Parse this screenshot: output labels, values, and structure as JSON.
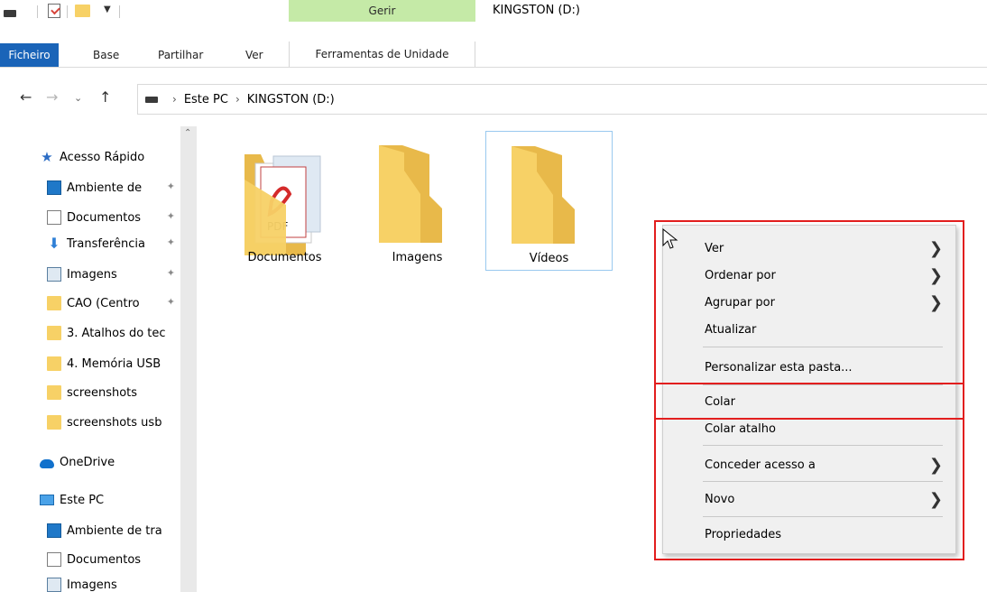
{
  "window": {
    "title": "KINGSTON (D:)",
    "contextual_group": "Gerir"
  },
  "ribbon": {
    "tabs": [
      "Ficheiro",
      "Base",
      "Partilhar",
      "Ver",
      "Ferramentas de Unidade"
    ],
    "active_tab": "Ficheiro"
  },
  "address": {
    "crumbs": [
      "Este PC",
      "KINGSTON (D:)"
    ]
  },
  "sidebar": {
    "quick_access_label": "Acesso Rápido",
    "quick_items": [
      {
        "label": "Ambiente de",
        "icon": "desktop-icon",
        "pinned": true
      },
      {
        "label": "Documentos",
        "icon": "documents-icon",
        "pinned": true
      },
      {
        "label": "Transferência",
        "icon": "download-icon",
        "pinned": true
      },
      {
        "label": "Imagens",
        "icon": "pictures-icon",
        "pinned": true
      },
      {
        "label": "CAO (Centro",
        "icon": "folder-icon",
        "pinned": true
      },
      {
        "label": "3. Atalhos do tec",
        "icon": "folder-icon",
        "pinned": false
      },
      {
        "label": "4. Memória USB",
        "icon": "folder-icon",
        "pinned": false
      },
      {
        "label": "screenshots",
        "icon": "folder-icon",
        "pinned": false
      },
      {
        "label": "screenshots usb",
        "icon": "folder-icon",
        "pinned": false
      }
    ],
    "onedrive_label": "OneDrive",
    "this_pc_label": "Este PC",
    "pc_items": [
      {
        "label": "Ambiente de tra",
        "icon": "desktop-icon"
      },
      {
        "label": "Documentos",
        "icon": "documents-icon"
      },
      {
        "label": "Imagens",
        "icon": "pictures-icon"
      }
    ]
  },
  "files": [
    {
      "name": "Documentos",
      "icon": "pdf-folder-icon",
      "selected": false
    },
    {
      "name": "Imagens",
      "icon": "folder-icon",
      "selected": false
    },
    {
      "name": "Vídeos",
      "icon": "folder-icon",
      "selected": true
    }
  ],
  "context_menu": {
    "items": [
      {
        "label": "Ver",
        "submenu": true
      },
      {
        "label": "Ordenar por",
        "submenu": true
      },
      {
        "label": "Agrupar por",
        "submenu": true
      },
      {
        "label": "Atualizar",
        "submenu": false
      },
      {
        "label": "Personalizar esta pasta...",
        "submenu": false
      },
      {
        "label": "Colar",
        "submenu": false,
        "highlighted": true
      },
      {
        "label": "Colar atalho",
        "submenu": false
      },
      {
        "label": "Conceder acesso a",
        "submenu": true
      },
      {
        "label": "Novo",
        "submenu": true
      },
      {
        "label": "Propriedades",
        "submenu": false
      }
    ]
  },
  "colors": {
    "file_tab": "#1a64b8",
    "contextual_tab": "#c5eaa7",
    "highlight_border": "#e21e1e",
    "folder": "#f7d166",
    "selection_border": "#99c9ef"
  }
}
